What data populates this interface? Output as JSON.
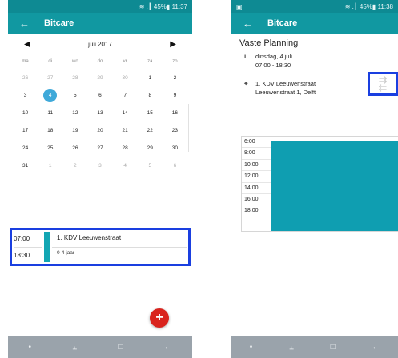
{
  "left_screen": {
    "status": {
      "icons": "≋ .┃ 45%▮",
      "time": "11:37"
    },
    "appbar": {
      "back_icon": "←",
      "title": "Bitcare"
    },
    "calendar": {
      "month_label": "juli 2017",
      "prev_icon": "◀",
      "next_icon": "▶",
      "weekdays": [
        "ma",
        "di",
        "wo",
        "do",
        "vr",
        "za",
        "zo"
      ],
      "weeks": [
        [
          "26",
          "27",
          "28",
          "29",
          "30",
          "1",
          "2"
        ],
        [
          "3",
          "4",
          "5",
          "6",
          "7",
          "8",
          "9"
        ],
        [
          "10",
          "11",
          "12",
          "13",
          "14",
          "15",
          "16"
        ],
        [
          "17",
          "18",
          "19",
          "20",
          "21",
          "22",
          "23"
        ],
        [
          "24",
          "25",
          "26",
          "27",
          "28",
          "29",
          "30"
        ],
        [
          "31",
          "1",
          "2",
          "3",
          "4",
          "5",
          "6"
        ]
      ],
      "selected": "4"
    },
    "event": {
      "start": "07:00",
      "end": "18:30",
      "title": "1. KDV Leeuwenstraat",
      "subtitle": "0-4 jaar",
      "color": "#13a6b3"
    },
    "fab_label": "+",
    "nav": {
      "dot": "•",
      "recent": "⫠",
      "home": "□",
      "back": "←"
    }
  },
  "right_screen": {
    "status": {
      "left_icon": "▣",
      "icons": "≋ .┃ 45%▮",
      "time": "11:38"
    },
    "appbar": {
      "back_icon": "←",
      "title": "Bitcare"
    },
    "title": "Vaste Planning",
    "date_line": "dinsdag, 4 juli",
    "time_line": "07:00 - 18:30",
    "location_line1": "1. KDV Leeuwenstraat",
    "location_line2": "Leeuwenstraat 1, Delft",
    "info_glyph": "i",
    "pin_glyph": "⌖",
    "swap_icon_top": "⇉",
    "swap_icon_bottom": "⇇",
    "timeline_hours": [
      "6:00",
      "8:00",
      "10:00",
      "12:00",
      "14:00",
      "16:00",
      "18:00"
    ],
    "nav": {
      "dot": "•",
      "recent": "⫠",
      "home": "□",
      "back": "←"
    }
  }
}
